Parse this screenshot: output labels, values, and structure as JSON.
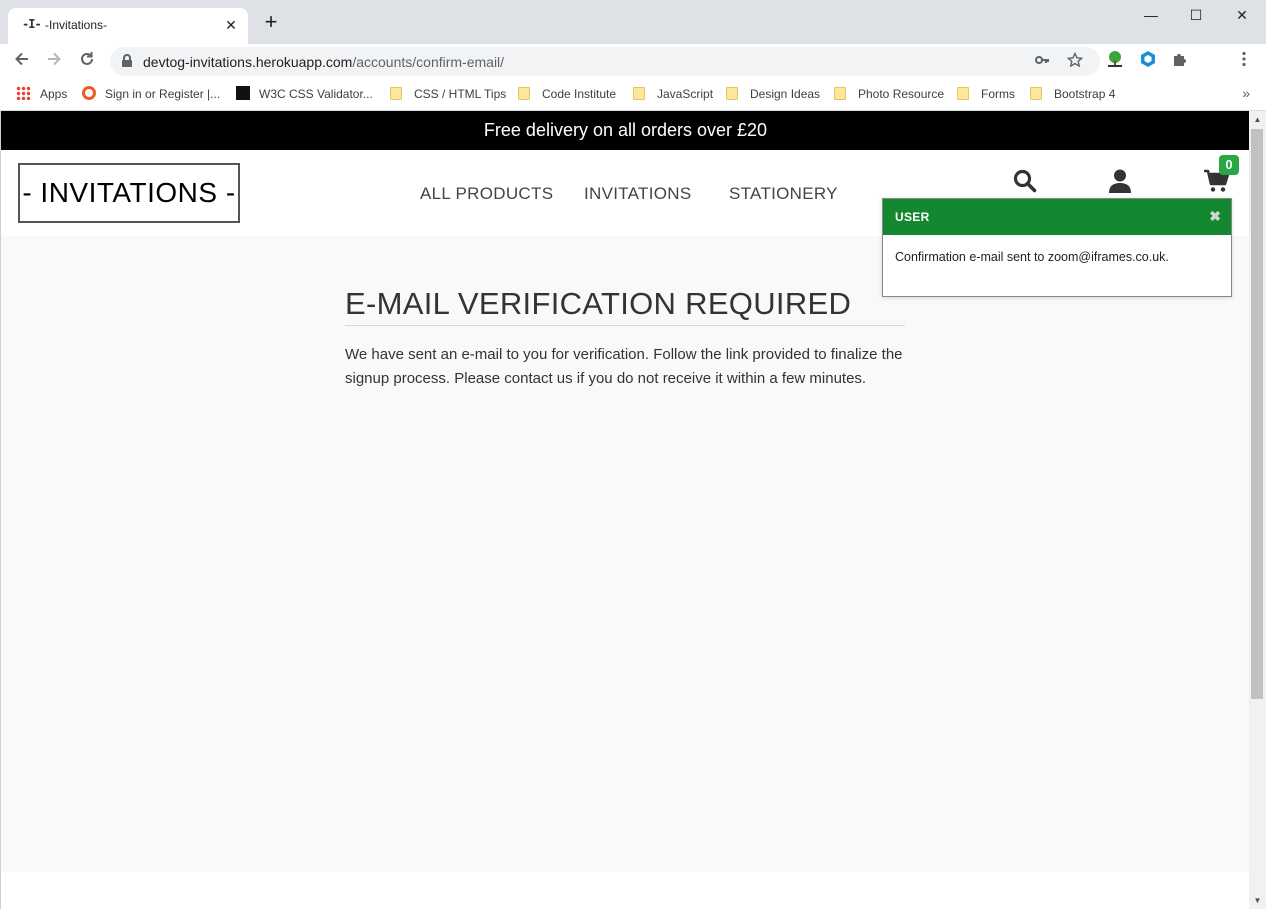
{
  "browser": {
    "tab_favicon": "-I-",
    "tab_title": "-Invitations-",
    "tab_close": "✕",
    "new_tab": "+",
    "window_controls": {
      "minimize": "—",
      "maximize": "☐",
      "close": "✕"
    },
    "url_host": "devtog-invitations.herokuapp.com",
    "url_path": "/accounts/confirm-email/",
    "bookmarks": [
      {
        "label": "Apps",
        "icon": "apps-grid-icon"
      },
      {
        "label": "Sign in or Register |...",
        "icon": "ring-icon"
      },
      {
        "label": "W3C CSS Validator...",
        "icon": "w3c-icon"
      },
      {
        "label": "CSS / HTML Tips",
        "icon": "folder-icon"
      },
      {
        "label": "Code Institute",
        "icon": "folder-icon"
      },
      {
        "label": "JavaScript",
        "icon": "folder-icon"
      },
      {
        "label": "Design Ideas",
        "icon": "folder-icon"
      },
      {
        "label": "Photo Resource",
        "icon": "folder-icon"
      },
      {
        "label": "Forms",
        "icon": "folder-icon"
      },
      {
        "label": "Bootstrap 4",
        "icon": "folder-icon"
      }
    ],
    "bookmarks_more": "»"
  },
  "site": {
    "promo": "Free delivery on all orders over £20",
    "logo": "- INVITATIONS -",
    "nav": [
      {
        "label": "ALL PRODUCTS"
      },
      {
        "label": "INVITATIONS"
      },
      {
        "label": "STATIONERY"
      }
    ],
    "cart_count": "0"
  },
  "main": {
    "heading": "E-MAIL VERIFICATION REQUIRED",
    "body": "We have sent an e-mail to you for verification. Follow the link provided to finalize the signup process. Please contact us if you do not receive it within a few minutes."
  },
  "toast": {
    "title": "USER",
    "close": "✖",
    "message": "Confirmation e-mail sent to zoom@iframes.co.uk."
  },
  "colors": {
    "toast_header": "#138831",
    "cart_badge": "#28a745",
    "promo_bar": "#000000"
  }
}
